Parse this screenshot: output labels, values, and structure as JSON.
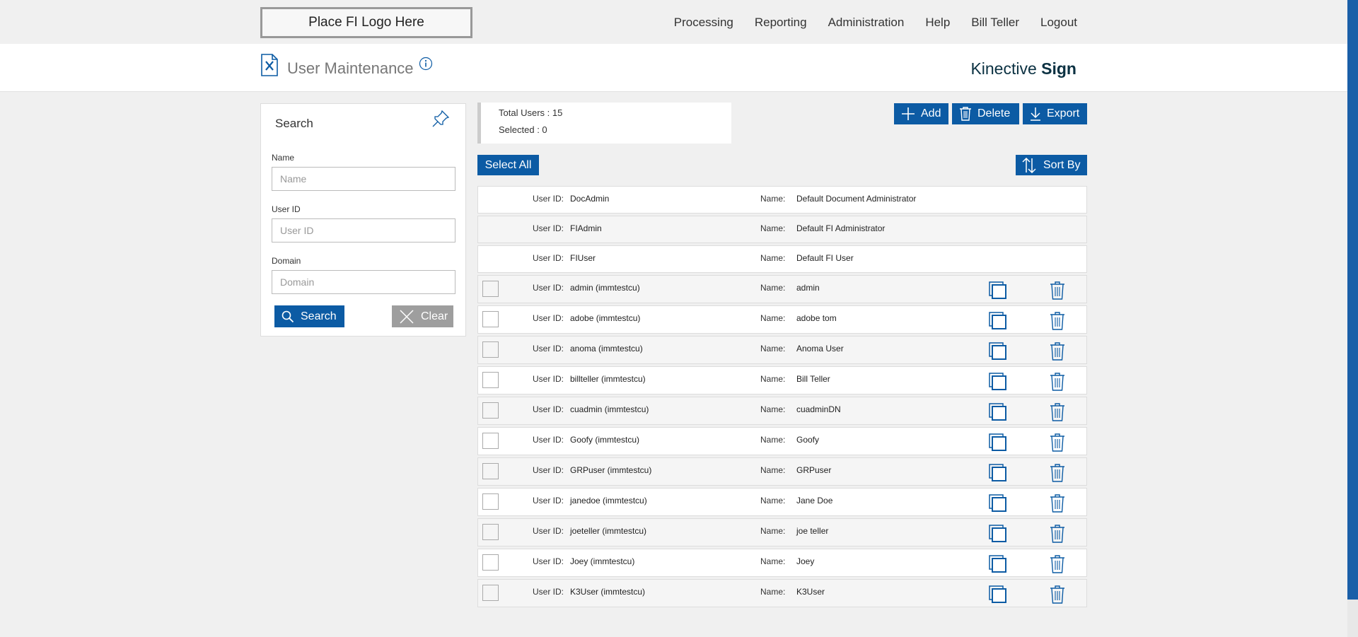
{
  "header": {
    "logo_text": "Place FI Logo Here",
    "nav": [
      "Processing",
      "Reporting",
      "Administration",
      "Help",
      "Bill Teller",
      "Logout"
    ]
  },
  "titlebar": {
    "title": "User Maintenance",
    "brand_regular": "Kinective ",
    "brand_bold": "Sign"
  },
  "search": {
    "title": "Search",
    "name_label": "Name",
    "name_placeholder": "Name",
    "userid_label": "User ID",
    "userid_placeholder": "User ID",
    "domain_label": "Domain",
    "domain_placeholder": "Domain",
    "search_button": "Search",
    "clear_button": "Clear"
  },
  "summary": {
    "total_users": "Total Users : 15",
    "selected": "Selected : 0"
  },
  "actions": {
    "add": "Add",
    "delete": "Delete",
    "export": "Export",
    "select_all": "Select All",
    "sort_by": "Sort By"
  },
  "labels": {
    "user_id": "User ID:",
    "name": "Name:"
  },
  "users": [
    {
      "user_id": "DocAdmin",
      "name": "Default Document Administrator",
      "system": true
    },
    {
      "user_id": "FIAdmin",
      "name": "Default FI Administrator",
      "system": true
    },
    {
      "user_id": "FIUser",
      "name": "Default FI User",
      "system": true
    },
    {
      "user_id": "admin (immtestcu)",
      "name": "admin",
      "system": false
    },
    {
      "user_id": "adobe (immtestcu)",
      "name": "adobe tom",
      "system": false
    },
    {
      "user_id": "anoma (immtestcu)",
      "name": "Anoma User",
      "system": false
    },
    {
      "user_id": "billteller (immtestcu)",
      "name": "Bill Teller",
      "system": false
    },
    {
      "user_id": "cuadmin (immtestcu)",
      "name": "cuadminDN",
      "system": false
    },
    {
      "user_id": "Goofy (immtestcu)",
      "name": "Goofy",
      "system": false
    },
    {
      "user_id": "GRPuser (immtestcu)",
      "name": "GRPuser",
      "system": false
    },
    {
      "user_id": "janedoe (immtestcu)",
      "name": "Jane Doe",
      "system": false
    },
    {
      "user_id": "joeteller (immtestcu)",
      "name": "joe teller",
      "system": false
    },
    {
      "user_id": "Joey (immtestcu)",
      "name": "Joey",
      "system": false
    },
    {
      "user_id": "K3User (immtestcu)",
      "name": "K3User",
      "system": false
    }
  ],
  "colors": {
    "accent": "#0c5ba4",
    "clear_button": "#9e9e9e",
    "brand_text": "#0b3142"
  }
}
